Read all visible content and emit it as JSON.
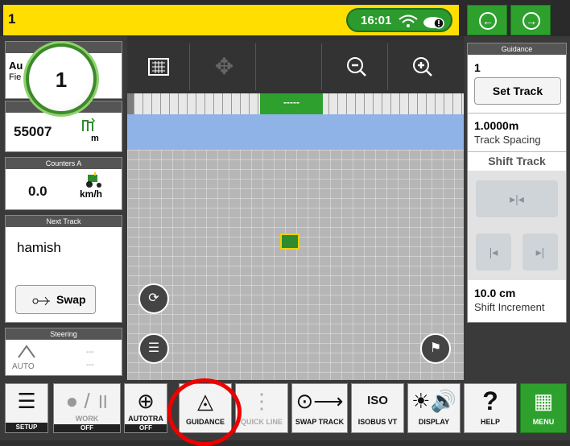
{
  "topbar": {
    "number": "1",
    "time": "16:01"
  },
  "left": {
    "badge": "1",
    "panel1_line1": "Au",
    "panel1_line2": "Fie",
    "counter_value": "55007",
    "counter_unit": "m",
    "counters_header": "Counters A",
    "speed_value": "0.0",
    "speed_unit": "km/h",
    "next_track_header": "Next Track",
    "next_track_value": "hamish",
    "swap_label": "Swap",
    "steering_header": "Steering",
    "steering_auto": "AUTO",
    "steering_placeholder": "---"
  },
  "view": {
    "lightbar_label": "-----"
  },
  "right": {
    "header": "Guidance",
    "track_number": "1",
    "set_track_label": "Set Track",
    "track_spacing_value": "1.0000m",
    "track_spacing_label": "Track Spacing",
    "shift_track_label": "Shift Track",
    "shift_increment_value": "10.0 cm",
    "shift_increment_label": "Shift Increment"
  },
  "bottom": {
    "setup": "SETUP",
    "work": "WORK",
    "work_state": "OFF",
    "autotrac": "AUTOTRA",
    "autotrac_state": "OFF",
    "guidance": "GUIDANCE",
    "quick_line": "QUICK LINE",
    "swap_track": "SWAP TRACK",
    "isobus": "ISOBUS VT",
    "display": "DISPLAY",
    "help": "HELP",
    "menu": "MENU"
  }
}
